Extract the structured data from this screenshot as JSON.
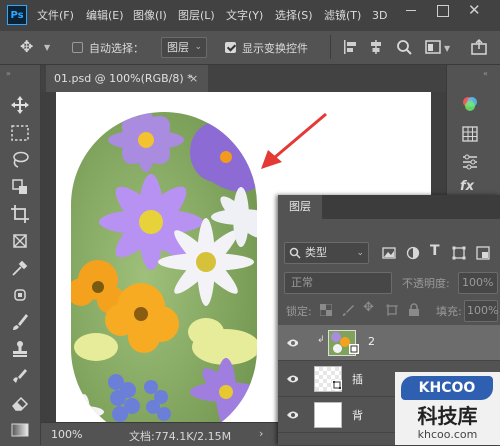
{
  "app": {
    "logo": "Ps"
  },
  "menu": [
    "文件(F)",
    "编辑(E)",
    "图像(I)",
    "图层(L)",
    "文字(Y)",
    "选择(S)",
    "滤镜(T)",
    "3D"
  ],
  "options": {
    "auto_select_label": "自动选择：",
    "auto_select_target": "图层",
    "show_transform_label": "显示变换控件"
  },
  "document": {
    "tab_title": "01.psd @ 100%(RGB/8) *",
    "zoom": "100%",
    "doc_info": "文档:774.1K/2.15M"
  },
  "layers_panel": {
    "title": "图层",
    "filter_kind": "类型",
    "blend_mode": "正常",
    "opacity_label": "不透明度:",
    "opacity_value": "100%",
    "lock_label": "锁定:",
    "fill_label": "填充:",
    "fill_value": "100%",
    "layers": [
      {
        "name": "2",
        "selected": true
      },
      {
        "name": "插"
      },
      {
        "name": "背"
      }
    ]
  },
  "watermark": {
    "brand": "KHCOO",
    "name": "科技库",
    "url": "khcoo.com"
  },
  "colors": {
    "accent": "#31a8ff",
    "arrow": "#e53935"
  }
}
